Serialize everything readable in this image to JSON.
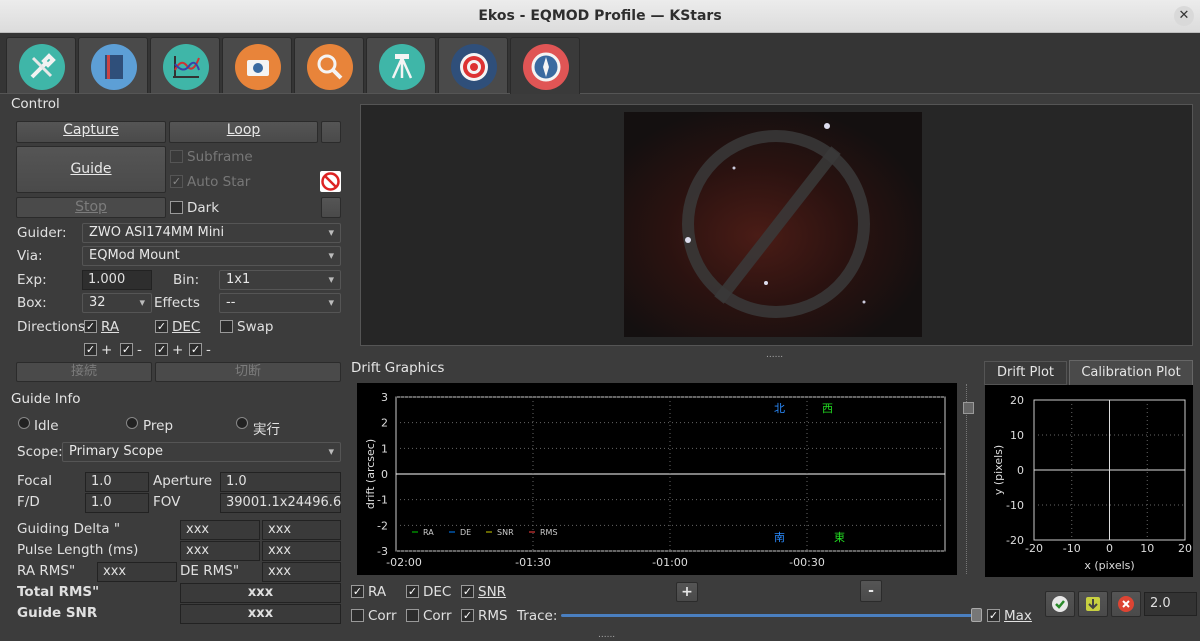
{
  "window": {
    "title": "Ekos - EQMOD Profile — KStars",
    "close": "✕"
  },
  "tabs": [
    {
      "icon": "setup-icon"
    },
    {
      "icon": "scheduler-icon"
    },
    {
      "icon": "analyze-icon"
    },
    {
      "icon": "capture-icon"
    },
    {
      "icon": "focus-icon"
    },
    {
      "icon": "mount-icon"
    },
    {
      "icon": "align-icon"
    },
    {
      "icon": "guide-icon"
    }
  ],
  "control": {
    "title": "Control",
    "capture": "Capture",
    "loop": "Loop",
    "guide": "Guide",
    "stop": "Stop",
    "subframe": "Subframe",
    "autostar": "Auto Star",
    "dark": "Dark",
    "guider_label": "Guider:",
    "guider_value": "ZWO ASI174MM Mini",
    "via_label": "Via:",
    "via_value": "EQMod Mount",
    "exp_label": "Exp:",
    "exp_value": "1.000",
    "bin_label": "Bin:",
    "bin_value": "1x1",
    "box_label": "Box:",
    "box_value": "32",
    "effects_label": "Effects",
    "effects_value": "--",
    "directions_label": "Directions",
    "ra": "RA",
    "dec": "DEC",
    "swap": "Swap",
    "plus": "+",
    "minus": "-",
    "connect": "接続",
    "disconnect": "切断"
  },
  "guideinfo": {
    "title": "Guide Info",
    "idle": "Idle",
    "prep": "Prep",
    "run": "実行",
    "scope_label": "Scope:",
    "scope_value": "Primary Scope",
    "focal_label": "Focal",
    "focal_value": "1.0",
    "aperture_label": "Aperture",
    "aperture_value": "1.0",
    "fd_label": "F/D",
    "fd_value": "1.0",
    "fov_label": "FOV",
    "fov_value": "39001.1x24496.6",
    "delta_label": "Guiding Delta \"",
    "delta_a": "xxx",
    "delta_b": "xxx",
    "pulse_label": "Pulse Length (ms)",
    "pulse_a": "xxx",
    "pulse_b": "xxx",
    "rarms_label": "RA RMS\"",
    "rarms_value": "xxx",
    "derms_label": "DE RMS\"",
    "derms_value": "xxx",
    "total_label": "Total RMS\"",
    "total_value": "xxx",
    "snr_label": "Guide SNR",
    "snr_value": "xxx"
  },
  "drift": {
    "title": "Drift Graphics",
    "plus": "+",
    "minus": "-",
    "ra": "RA",
    "dec": "DEC",
    "snr": "SNR",
    "corr1": "Corr",
    "corr2": "Corr",
    "rms": "RMS",
    "trace": "Trace:",
    "max": "Max",
    "zoom": "2.0",
    "tab_drift": "Drift Plot",
    "tab_calib": "Calibration Plot",
    "splitter": "......"
  },
  "chart_data": [
    {
      "type": "line",
      "ylabel": "drift (arcsec)",
      "xlabel": "",
      "ylim": [
        -3,
        3
      ],
      "yticks": [
        "3",
        "2",
        "1",
        "0",
        "-1",
        "-2",
        "-3"
      ],
      "xticks": [
        "-02:00",
        "-01:30",
        "-01:00",
        "-00:30"
      ],
      "legend": [
        {
          "name": "RA",
          "color": "#00cc00"
        },
        {
          "name": "DE",
          "color": "#0080ff"
        },
        {
          "name": "SNR",
          "color": "#cccc00"
        },
        {
          "name": "RMS",
          "color": "#ff4040"
        }
      ],
      "compass": {
        "n": "北",
        "w": "西",
        "s": "南",
        "e": "東"
      },
      "series": []
    },
    {
      "type": "scatter",
      "xlabel": "x (pixels)",
      "ylabel": "y (pixels)",
      "xlim": [
        -20,
        20
      ],
      "ylim": [
        -20,
        20
      ],
      "xticks": [
        "-20",
        "-10",
        "0",
        "10",
        "20"
      ],
      "yticks": [
        "20",
        "10",
        "0",
        "-10",
        "-20"
      ],
      "series": []
    }
  ]
}
